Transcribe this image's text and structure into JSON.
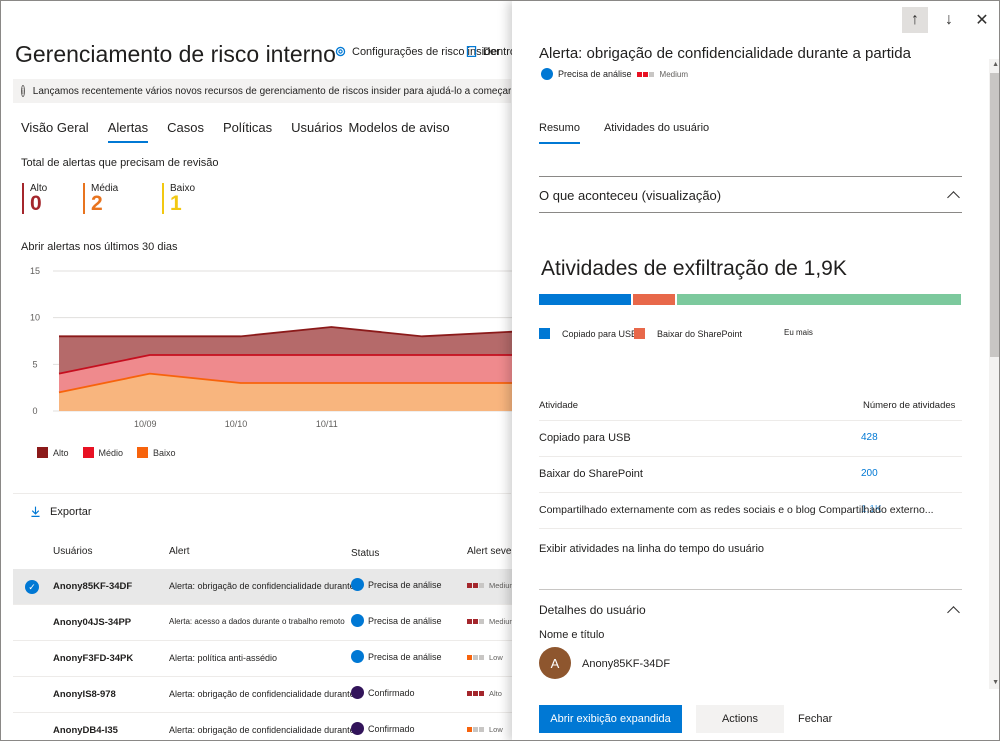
{
  "page": {
    "title": "Gerenciamento de risco interno",
    "settings_label": "Configurações de risco insider",
    "inside_label": "Dentro",
    "banner": "Lançamos recentemente vários novos recursos de gerenciamento de riscos insider para ajudá-lo a começar mais rápido e"
  },
  "tabs": [
    "Visão Geral",
    "Alertas",
    "Casos",
    "Políticas",
    "Usuários",
    "Modelos de aviso"
  ],
  "summary": {
    "label": "Total de alertas que precisam de revisão",
    "severities": [
      {
        "label": "Alto",
        "count": "0",
        "color": "#a4262c"
      },
      {
        "label": "Média",
        "count": "2",
        "color": "#e8741f"
      },
      {
        "label": "Baixo",
        "count": "1",
        "color": "#f2c811"
      }
    ]
  },
  "chart_data": {
    "type": "area",
    "title": "Abrir alertas nos últimos 30 dias",
    "x_ticks": [
      "10/09",
      "10/10",
      "10/11"
    ],
    "y_ticks": [
      "15",
      "10",
      "5",
      "0"
    ],
    "ylim": [
      0,
      15
    ],
    "x": [
      0,
      1,
      2,
      3,
      4,
      5
    ],
    "series": [
      {
        "name": "Alto",
        "color": "#a4262c",
        "values": [
          8,
          8,
          8,
          9,
          8,
          8.5
        ]
      },
      {
        "name": "Médio",
        "color": "#e81123",
        "values": [
          4,
          6,
          6,
          6,
          6,
          6
        ]
      },
      {
        "name": "Baixo",
        "color": "#f7630c",
        "values": [
          2,
          4,
          3,
          3,
          3,
          3
        ]
      }
    ]
  },
  "export_label": "Exportar",
  "table": {
    "headers": [
      "Usuários",
      "Alert",
      "Status",
      "Alert seve"
    ],
    "rows": [
      {
        "user": "Anony85KF-34DF",
        "alert": "Alerta: obrigação de confidencialidade durante a partida",
        "status": "Precisa de análise",
        "status_color": "#0078d4",
        "sev": "Medium",
        "sev_colors": [
          "#a4262c",
          "#a4262c",
          "#c8c6c4"
        ],
        "selected": true
      },
      {
        "user": "Anony04JS-34PP",
        "alert": "Alerta: acesso a dados durante o trabalho remoto",
        "status": "Precisa de análise",
        "status_color": "#0078d4",
        "sev": "Medium",
        "sev_colors": [
          "#a4262c",
          "#a4262c",
          "#c8c6c4"
        ],
        "selected": false
      },
      {
        "user": "AnonyF3FD-34PK",
        "alert": "Alerta: política anti-assédio",
        "status": "Precisa de análise",
        "status_color": "#0078d4",
        "sev": "Low",
        "sev_colors": [
          "#f7630c",
          "#c8c6c4",
          "#c8c6c4"
        ],
        "selected": false
      },
      {
        "user": "AnonyIS8-978",
        "alert": "Alerta: obrigação de confidencialidade durante a partida",
        "status": "Confirmado",
        "status_color": "#32145a",
        "sev": "Alto",
        "sev_colors": [
          "#a4262c",
          "#a4262c",
          "#a4262c"
        ],
        "selected": false
      },
      {
        "user": "AnonyDB4-I35",
        "alert": "Alerta: obrigação de confidencialidade durante a partida",
        "status": "Confirmado",
        "status_color": "#32145a",
        "sev": "Low",
        "sev_colors": [
          "#f7630c",
          "#c8c6c4",
          "#c8c6c4"
        ],
        "selected": false
      }
    ]
  },
  "panel": {
    "title": "Alerta: obrigação de confidencialidade durante a partida",
    "status": "Precisa de análise",
    "severity": "Medium",
    "tabs": [
      "Resumo",
      "Atividades do usuário"
    ],
    "what_happened": "O que aconteceu (visualização)",
    "exfil_title": "Atividades de exfiltração de 1,9K",
    "bar_segments": [
      {
        "label": "Copiado para USB",
        "color": "#0078d4",
        "fraction": 0.22
      },
      {
        "label": "Baixar do SharePoint",
        "color": "#e8684a",
        "fraction": 0.1
      },
      {
        "label": "Eu mais",
        "color": "#7cc99d",
        "fraction": 0.68
      }
    ],
    "activity_header": "Atividade",
    "count_header": "Número de atividades",
    "activities": [
      {
        "name": "Copiado para USB",
        "count": "428"
      },
      {
        "name": "Baixar do SharePoint",
        "count": "200"
      },
      {
        "name": "Compartilhado externamente com as redes sociais e o blog Compartilhado externo...",
        "count": "1,1K"
      }
    ],
    "timeline_link": "Exibir atividades na linha do tempo do usuário",
    "user_details": "Detalhes do usuário",
    "name_title": "Nome e título",
    "avatar_letter": "A",
    "user_name": "Anony85KF-34DF",
    "btn_expand": "Abrir exibição expandida",
    "btn_actions": "Actions",
    "btn_close": "Fechar"
  }
}
